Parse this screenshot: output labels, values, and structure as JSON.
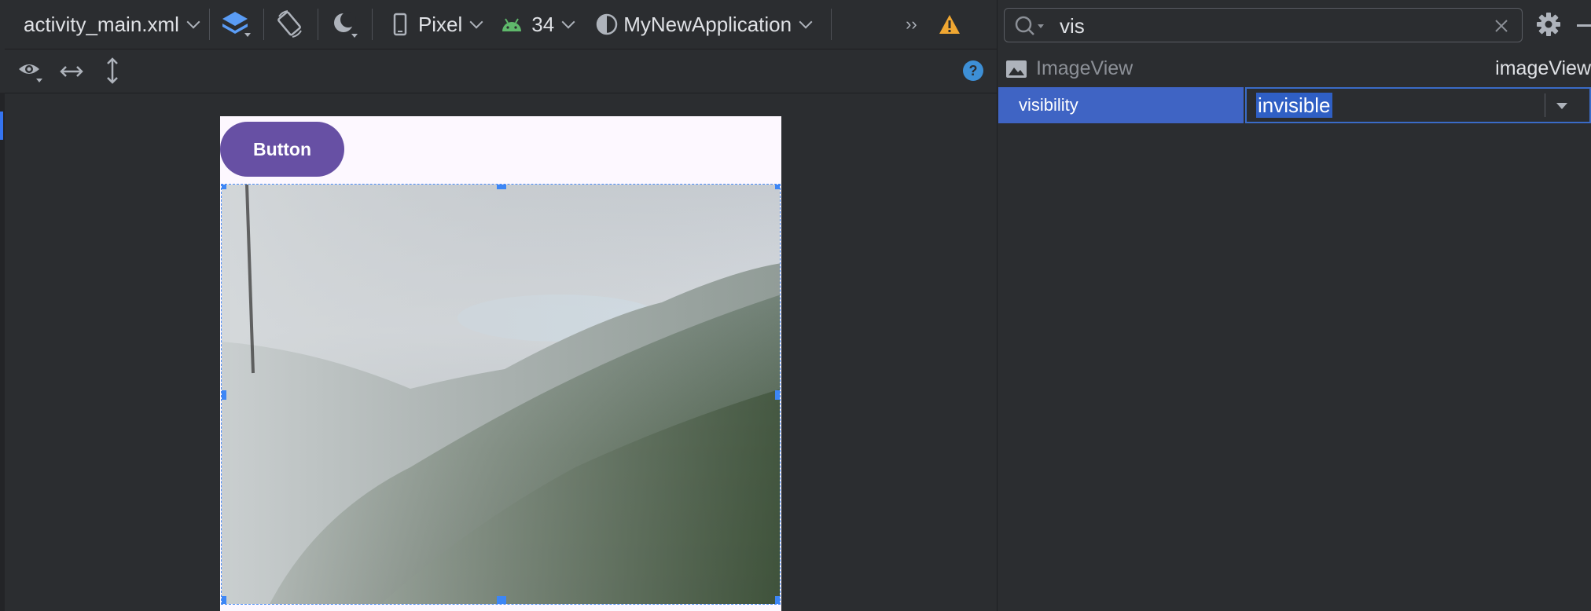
{
  "toolbar": {
    "file_tab": "activity_main.xml",
    "device": "Pixel",
    "api_level": "34",
    "theme": "MyNewApplication",
    "overflow_icon": "double-chevron-icon",
    "warning_icon": "warning-icon"
  },
  "preview": {
    "button_label": "Button"
  },
  "attributes": {
    "search_value": "vis",
    "component_type": "ImageView",
    "component_id": "imageView",
    "property_name": "visibility",
    "property_value": "invisible"
  },
  "colors": {
    "accent": "#3574f0",
    "selection": "#3f64c4",
    "button": "#6750a4",
    "warning": "#f0a732"
  }
}
